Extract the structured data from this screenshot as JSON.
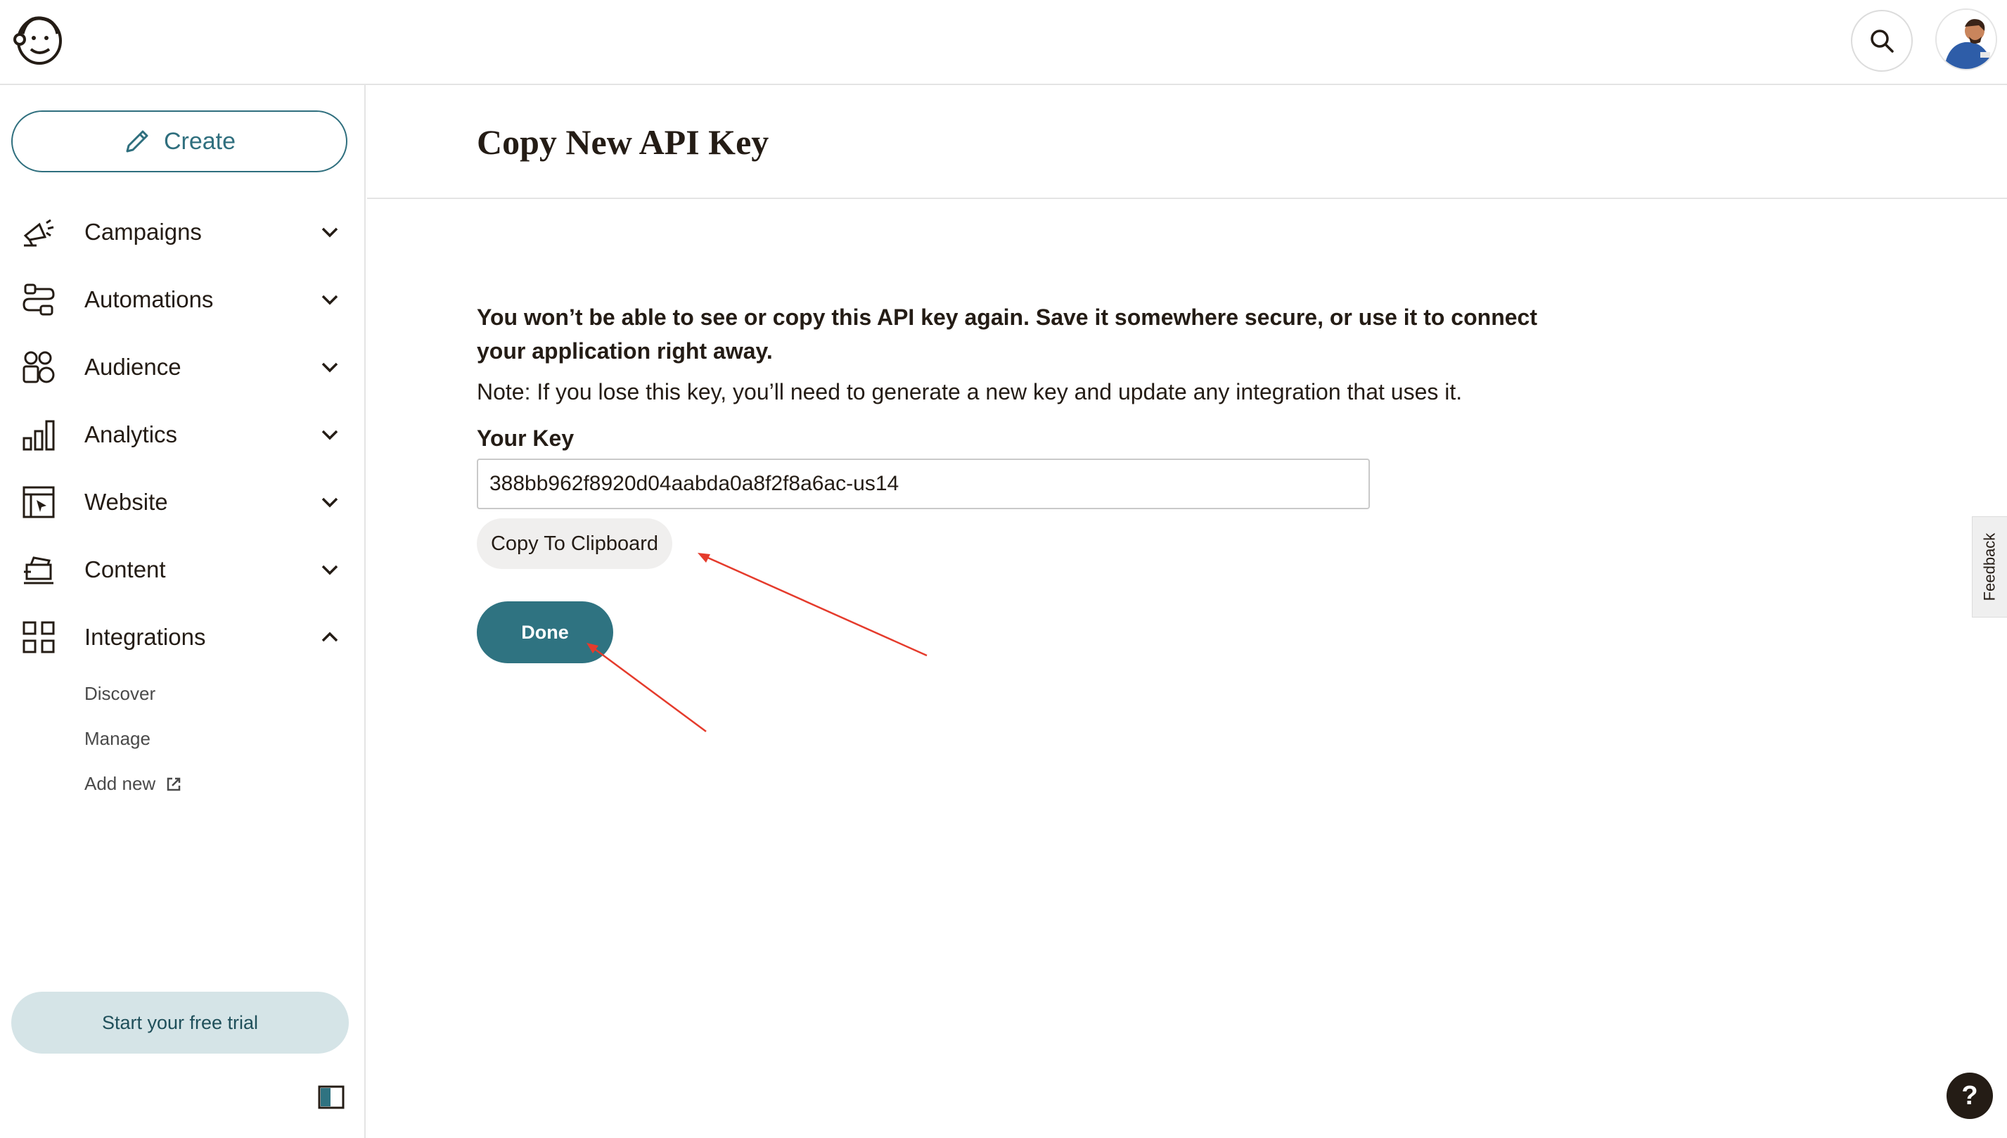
{
  "header": {
    "logo_icon": "mailchimp-freddie-logo",
    "search_icon": "search-icon",
    "avatar_icon": "user-avatar"
  },
  "sidebar": {
    "create_label": "Create",
    "items": [
      {
        "label": "Campaigns",
        "icon": "megaphone-icon",
        "expanded": false
      },
      {
        "label": "Automations",
        "icon": "automation-flow-icon",
        "expanded": false
      },
      {
        "label": "Audience",
        "icon": "audience-icon",
        "expanded": false
      },
      {
        "label": "Analytics",
        "icon": "bar-chart-icon",
        "expanded": false
      },
      {
        "label": "Website",
        "icon": "website-icon",
        "expanded": false
      },
      {
        "label": "Content",
        "icon": "content-icon",
        "expanded": false
      },
      {
        "label": "Integrations",
        "icon": "grid-icon",
        "expanded": true
      }
    ],
    "sub_items": [
      {
        "label": "Discover"
      },
      {
        "label": "Manage"
      },
      {
        "label": "Add new",
        "icon": "external-link-icon"
      }
    ],
    "trial_label": "Start your free trial"
  },
  "main": {
    "title": "Copy New API Key",
    "warning": "You won’t be able to see or copy this API key again. Save it somewhere secure, or use it to connect your application right away.",
    "note": "Note: If you lose this key, you’ll need to generate a new key and update any integration that uses it.",
    "key_label": "Your Key",
    "key_value": "388bb962f8920d04aabda0a8f2f8a6ac-us14",
    "copy_label": "Copy To Clipboard",
    "done_label": "Done"
  },
  "feedback_label": "Feedback",
  "help_label": "?",
  "colors": {
    "accent": "#2f7381",
    "annotation": "#e53b2c",
    "text": "#241c15"
  }
}
